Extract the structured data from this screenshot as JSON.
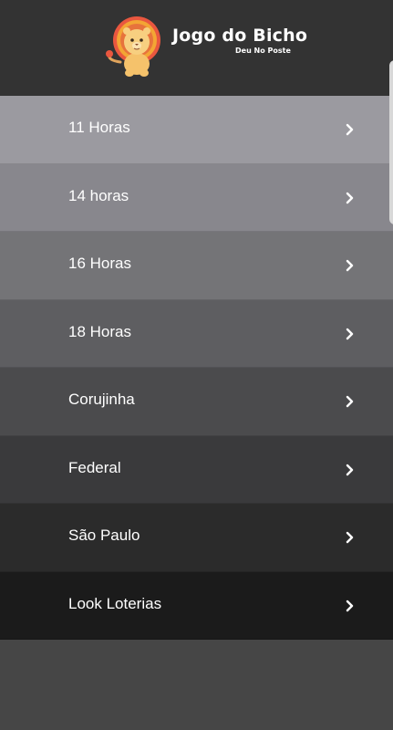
{
  "app": {
    "title": "Jogo do Bicho",
    "subtitle": "Deu No Poste",
    "logo_icon": "lion-mascot"
  },
  "menu": {
    "items": [
      {
        "label": "11 Horas",
        "bg": "#9b9aa0",
        "icon": "chevron-right-icon"
      },
      {
        "label": "14 horas",
        "bg": "#88878d",
        "icon": "chevron-right-icon"
      },
      {
        "label": "16 Horas",
        "bg": "#747477",
        "icon": "chevron-right-icon"
      },
      {
        "label": "18 Horas",
        "bg": "#5e5e61",
        "icon": "chevron-right-icon"
      },
      {
        "label": "Corujinha",
        "bg": "#4b4b4d",
        "icon": "chevron-right-icon"
      },
      {
        "label": "Federal",
        "bg": "#3a3a3c",
        "icon": "chevron-right-icon"
      },
      {
        "label": "São Paulo",
        "bg": "#2b2b2b",
        "icon": "chevron-right-icon"
      },
      {
        "label": "Look Loterias",
        "bg": "#1b1b1b",
        "icon": "chevron-right-icon"
      }
    ]
  },
  "colors": {
    "header_bg": "#333333",
    "page_bg": "#464646",
    "text": "#ffffff"
  }
}
